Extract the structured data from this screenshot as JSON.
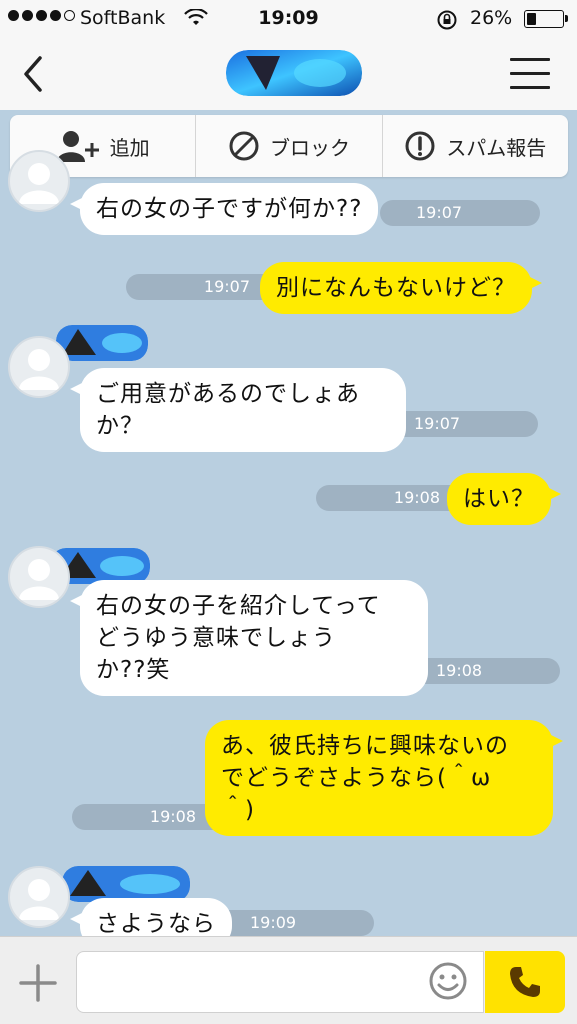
{
  "status_bar": {
    "carrier": "SoftBank",
    "time": "19:09",
    "battery_percent": "26%",
    "battery_level": 0.26
  },
  "nav": {
    "back_icon": "chevron-left-icon",
    "menu_icon": "hamburger-menu-icon"
  },
  "actions": [
    {
      "label": "追加",
      "icon": "add-user-icon"
    },
    {
      "label": "ブロック",
      "icon": "block-icon"
    },
    {
      "label": "スパム報告",
      "icon": "exclamation-circle-icon"
    }
  ],
  "messages": [
    {
      "side": "left",
      "lines": [
        "右の女の子ですが何か??"
      ],
      "time": "19:07"
    },
    {
      "side": "right",
      "lines": [
        "別になんもないけど？"
      ],
      "time": "19:07"
    },
    {
      "side": "left",
      "lines": [
        "ご用意があるのでしょあ",
        "か？"
      ],
      "time": "19:07"
    },
    {
      "side": "right",
      "lines": [
        "はい？"
      ],
      "time": "19:08"
    },
    {
      "side": "left",
      "lines": [
        "右の女の子を紹介してって",
        "どうゆう意味でしょう",
        "か??笑"
      ],
      "time": "19:08"
    },
    {
      "side": "right",
      "lines": [
        "あ、彼氏持ちに興味ないの",
        "でどうぞさようなら(＾ω",
        "＾)"
      ],
      "time": "19:08"
    },
    {
      "side": "left",
      "lines": [
        "さようなら"
      ],
      "time": "19:09"
    }
  ],
  "input": {
    "placeholder": "",
    "plus_icon": "plus-icon",
    "emoji_icon": "smiley-icon",
    "call_icon": "phone-icon"
  },
  "colors": {
    "background": "#b9cfe0",
    "outgoing_bubble": "#ffeb00",
    "incoming_bubble": "#ffffff",
    "time_pill": "#9fb2c2",
    "call_button": "#ffe200"
  }
}
